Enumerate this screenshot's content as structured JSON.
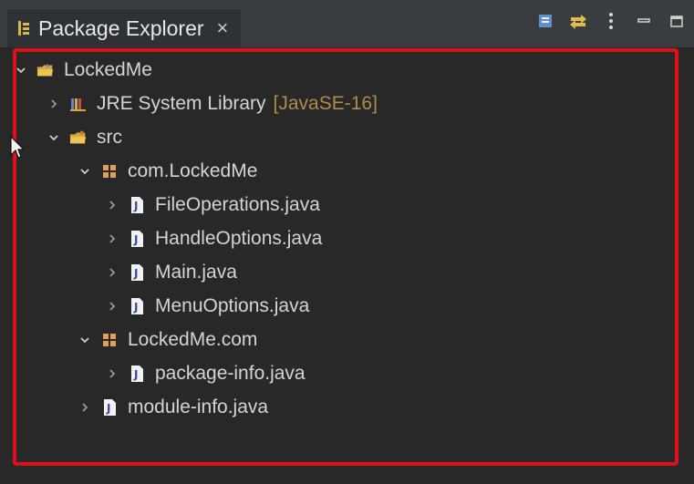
{
  "tab": {
    "title": "Package Explorer",
    "close_icon": "×"
  },
  "toolbar": {
    "buttons": [
      "collapse-all",
      "link-with-editor",
      "view-menu",
      "minimize",
      "maximize"
    ]
  },
  "tree": {
    "items": [
      {
        "label": "LockedMe",
        "decoration": ""
      },
      {
        "label": "JRE System Library",
        "decoration": "[JavaSE-16]"
      },
      {
        "label": "src",
        "decoration": ""
      },
      {
        "label": "com.LockedMe",
        "decoration": ""
      },
      {
        "label": "FileOperations.java",
        "decoration": ""
      },
      {
        "label": "HandleOptions.java",
        "decoration": ""
      },
      {
        "label": "Main.java",
        "decoration": ""
      },
      {
        "label": "MenuOptions.java",
        "decoration": ""
      },
      {
        "label": "LockedMe.com",
        "decoration": ""
      },
      {
        "label": "package-info.java",
        "decoration": ""
      },
      {
        "label": "module-info.java",
        "decoration": ""
      }
    ]
  },
  "colors": {
    "highlight": "#e0101a",
    "decoration": "#b08b4a",
    "text": "#d4d4d4"
  }
}
